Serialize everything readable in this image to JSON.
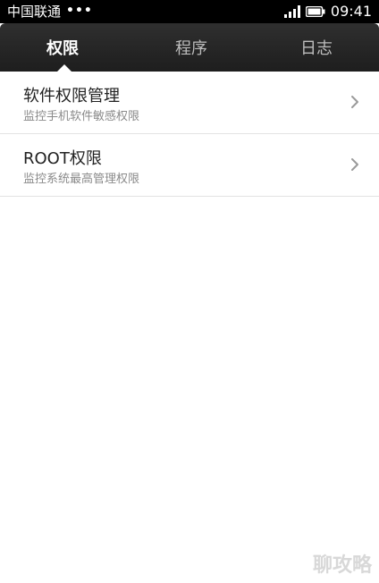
{
  "status_bar": {
    "carrier": "中国联通",
    "dots": "•••",
    "time": "09:41",
    "signal_icon": "signal-bars-icon",
    "battery_icon": "battery-icon"
  },
  "tabs": [
    {
      "label": "权限",
      "active": true
    },
    {
      "label": "程序",
      "active": false
    },
    {
      "label": "日志",
      "active": false
    }
  ],
  "list": {
    "items": [
      {
        "title": "软件权限管理",
        "subtitle": "监控手机软件敏感权限",
        "icon": "chevron-right-icon"
      },
      {
        "title": "ROOT权限",
        "subtitle": "监控系统最高管理权限",
        "icon": "chevron-right-icon"
      }
    ]
  },
  "watermark": {
    "text": "聊攻略"
  },
  "colors": {
    "tab_bar_bg": "#262626",
    "active_tab": "#ffffff",
    "inactive_tab": "#bdbdbd",
    "list_bg": "#ffffff",
    "divider": "#e3e3e3"
  }
}
